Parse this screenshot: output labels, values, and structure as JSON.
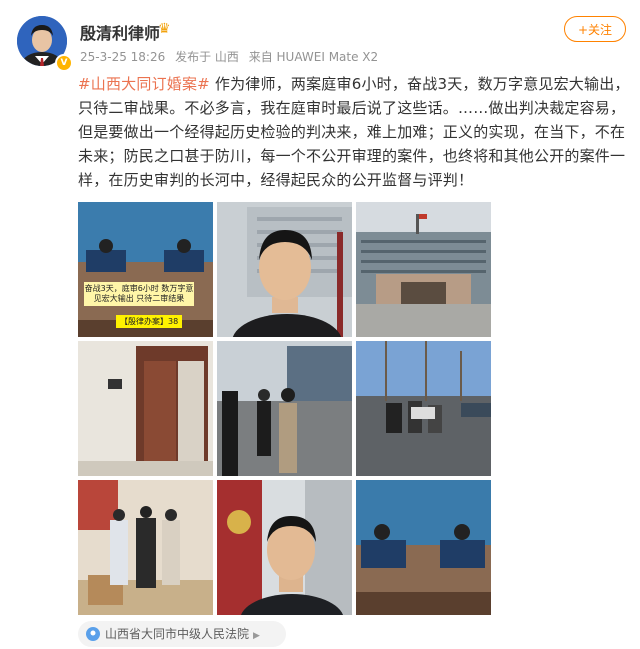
{
  "user": {
    "name": "殷清利律师",
    "avatar_icon": "person-portrait",
    "verified_icon": "verified-badge-icon",
    "crown_icon": "crown-icon"
  },
  "meta": {
    "date": "25-3-25 18:26",
    "published_in": "发布于 山西",
    "device": "来自 HUAWEI Mate X2"
  },
  "follow_button": "+关注",
  "post": {
    "topic": "#山西大同订婚案#",
    "body": " 作为律师，两案庭审6小时，奋战3天，数万字意见宏大输出，只待二审战果。不必多言，我在庭审时最后说了这些话。……做出判决裁定容易，但是要做出一个经得起历史检验的判决来，难上加难；正义的实现，在当下，不在未来；防民之口甚于防川，每一个不公开审理的案件，也终将和其他公开的案件一样，在历史审判的长河中，经得起民众的公开监督与评判！"
  },
  "photos": {
    "p1_caption": "奋战3天，庭审6小时 数万字意见宏大输出 只待二审结果",
    "p1_tag": "【殷律办案】38"
  },
  "location": {
    "text": "山西省大同市中级人民法院",
    "icon": "location-pin-icon"
  },
  "colors": {
    "accent": "#ff8200",
    "topic": "#eb7350",
    "meta": "#939393"
  }
}
